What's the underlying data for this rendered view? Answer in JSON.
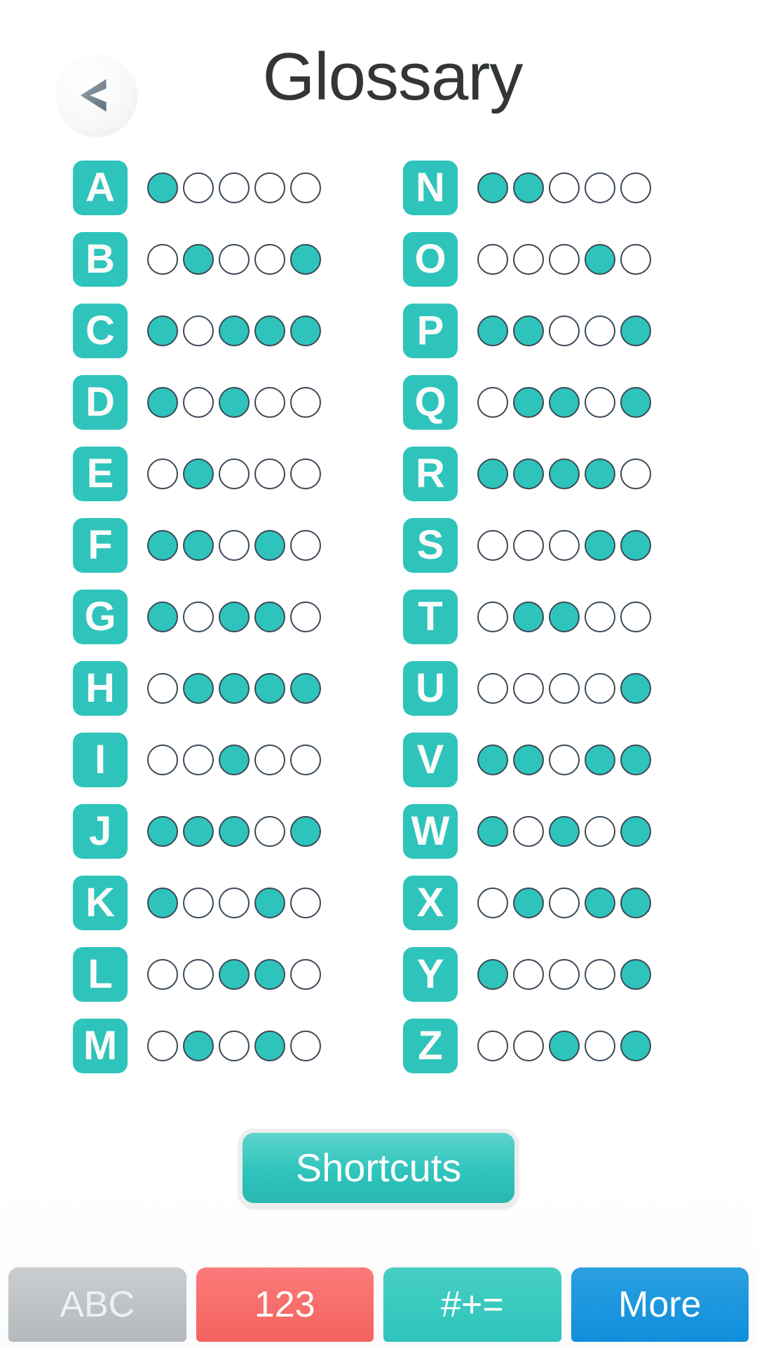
{
  "header": {
    "title": "Glossary",
    "back_icon": "chevron-left-icon"
  },
  "glossary": {
    "filled_color": "#2ec4bc",
    "empty_color": "#ffffff",
    "dot_border_color": "#3c4856",
    "tile_color": "#2ec4bc",
    "dots_per_row": 5,
    "left_column": [
      {
        "letter": "A",
        "dots": [
          1,
          0,
          0,
          0,
          0
        ]
      },
      {
        "letter": "B",
        "dots": [
          0,
          1,
          0,
          0,
          1
        ]
      },
      {
        "letter": "C",
        "dots": [
          1,
          0,
          1,
          1,
          1
        ]
      },
      {
        "letter": "D",
        "dots": [
          1,
          0,
          1,
          0,
          0
        ]
      },
      {
        "letter": "E",
        "dots": [
          0,
          1,
          0,
          0,
          0
        ]
      },
      {
        "letter": "F",
        "dots": [
          1,
          1,
          0,
          1,
          0
        ]
      },
      {
        "letter": "G",
        "dots": [
          1,
          0,
          1,
          1,
          0
        ]
      },
      {
        "letter": "H",
        "dots": [
          0,
          1,
          1,
          1,
          1
        ]
      },
      {
        "letter": "I",
        "dots": [
          0,
          0,
          1,
          0,
          0
        ]
      },
      {
        "letter": "J",
        "dots": [
          1,
          1,
          1,
          0,
          1
        ]
      },
      {
        "letter": "K",
        "dots": [
          1,
          0,
          0,
          1,
          0
        ]
      },
      {
        "letter": "L",
        "dots": [
          0,
          0,
          1,
          1,
          0
        ]
      },
      {
        "letter": "M",
        "dots": [
          0,
          1,
          0,
          1,
          0
        ]
      }
    ],
    "right_column": [
      {
        "letter": "N",
        "dots": [
          1,
          1,
          0,
          0,
          0
        ]
      },
      {
        "letter": "O",
        "dots": [
          0,
          0,
          0,
          1,
          0
        ]
      },
      {
        "letter": "P",
        "dots": [
          1,
          1,
          0,
          0,
          1
        ]
      },
      {
        "letter": "Q",
        "dots": [
          0,
          1,
          1,
          0,
          1
        ]
      },
      {
        "letter": "R",
        "dots": [
          1,
          1,
          1,
          1,
          0
        ]
      },
      {
        "letter": "S",
        "dots": [
          0,
          0,
          0,
          1,
          1
        ]
      },
      {
        "letter": "T",
        "dots": [
          0,
          1,
          1,
          0,
          0
        ]
      },
      {
        "letter": "U",
        "dots": [
          0,
          0,
          0,
          0,
          1
        ]
      },
      {
        "letter": "V",
        "dots": [
          1,
          1,
          0,
          1,
          1
        ]
      },
      {
        "letter": "W",
        "dots": [
          1,
          0,
          1,
          0,
          1
        ]
      },
      {
        "letter": "X",
        "dots": [
          0,
          1,
          0,
          1,
          1
        ]
      },
      {
        "letter": "Y",
        "dots": [
          1,
          0,
          0,
          0,
          1
        ]
      },
      {
        "letter": "Z",
        "dots": [
          0,
          0,
          1,
          0,
          1
        ]
      }
    ]
  },
  "shortcuts": {
    "label": "Shortcuts"
  },
  "bottom_bar": {
    "buttons": [
      {
        "label": "ABC",
        "color": "#b4b9bd",
        "state": "disabled"
      },
      {
        "label": "123",
        "color": "#f4635f",
        "state": "normal"
      },
      {
        "label": "#+=",
        "color": "#2ec4bc",
        "state": "normal"
      },
      {
        "label": "More",
        "color": "#0f8fdc",
        "state": "normal"
      }
    ]
  }
}
